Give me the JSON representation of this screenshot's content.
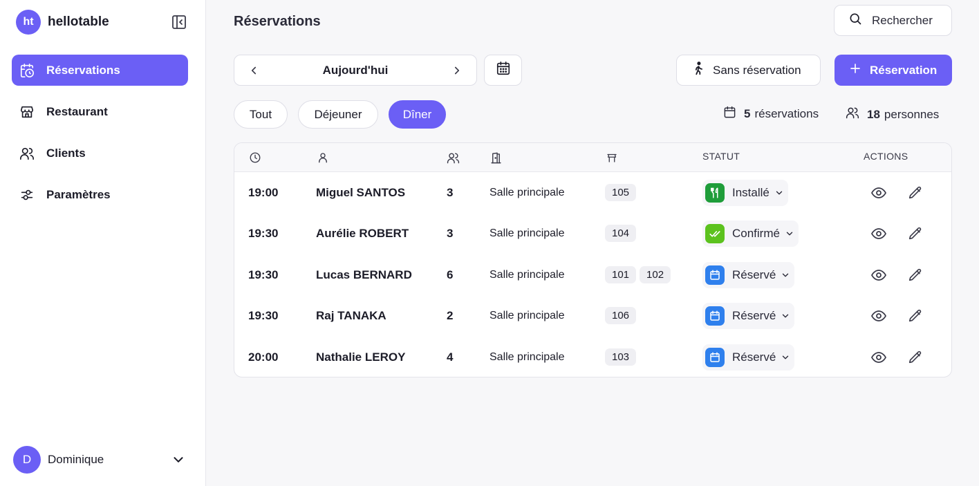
{
  "app": {
    "logo_text": "ht",
    "name": "hellotable"
  },
  "sidebar": {
    "items": [
      {
        "label": "Réservations",
        "icon": "calendar-clock-icon",
        "active": true
      },
      {
        "label": "Restaurant",
        "icon": "store-icon",
        "active": false
      },
      {
        "label": "Clients",
        "icon": "users-icon",
        "active": false
      },
      {
        "label": "Paramètres",
        "icon": "settings-sliders-icon",
        "active": false
      }
    ],
    "user": {
      "initial": "D",
      "name": "Dominique"
    }
  },
  "header": {
    "title": "Réservations",
    "search_label": "Rechercher"
  },
  "toolbar": {
    "date_label": "Aujourd'hui",
    "walkin_label": "Sans réservation",
    "add_label": "Réservation"
  },
  "filters": {
    "services": [
      {
        "label": "Tout",
        "active": false
      },
      {
        "label": "Déjeuner",
        "active": false
      },
      {
        "label": "Dîner",
        "active": true
      }
    ],
    "reservations_count": "5",
    "reservations_unit": "réservations",
    "people_count": "18",
    "people_unit": "personnes"
  },
  "table": {
    "headers": {
      "status": "STATUT",
      "actions": "ACTIONS"
    },
    "rows": [
      {
        "time": "19:00",
        "name": "Miguel SANTOS",
        "pax": "3",
        "room": "Salle principale",
        "tables": [
          "105"
        ],
        "status": "Installé",
        "status_type": "seated"
      },
      {
        "time": "19:30",
        "name": "Aurélie ROBERT",
        "pax": "3",
        "room": "Salle principale",
        "tables": [
          "104"
        ],
        "status": "Confirmé",
        "status_type": "confirmed"
      },
      {
        "time": "19:30",
        "name": "Lucas BERNARD",
        "pax": "6",
        "room": "Salle principale",
        "tables": [
          "101",
          "102"
        ],
        "status": "Réservé",
        "status_type": "booked"
      },
      {
        "time": "19:30",
        "name": "Raj TANAKA",
        "pax": "2",
        "room": "Salle principale",
        "tables": [
          "106"
        ],
        "status": "Réservé",
        "status_type": "booked"
      },
      {
        "time": "20:00",
        "name": "Nathalie LEROY",
        "pax": "4",
        "room": "Salle principale",
        "tables": [
          "103"
        ],
        "status": "Réservé",
        "status_type": "booked"
      }
    ]
  },
  "colors": {
    "accent": "#6b5ff5",
    "seated": "#1f9d3a",
    "confirmed": "#5cc21e",
    "booked": "#2f80ed"
  }
}
